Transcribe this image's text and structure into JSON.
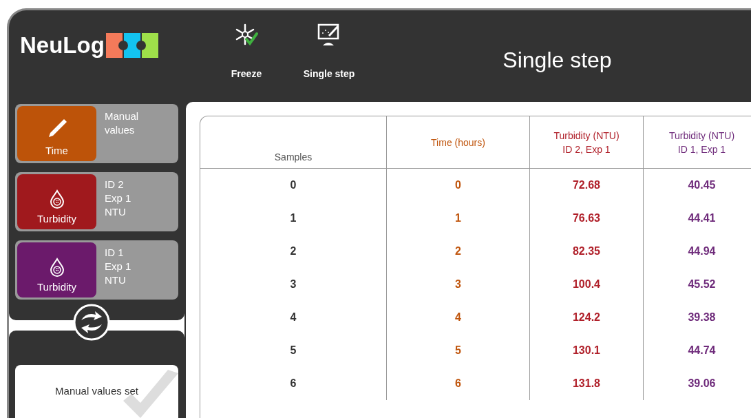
{
  "logo": {
    "text": "NeuLog"
  },
  "toolbar": [
    {
      "label": "Freeze",
      "kind": "freeze"
    },
    {
      "label": "Single step",
      "kind": "step"
    }
  ],
  "title": "Single step",
  "sensors": [
    {
      "name": "Time",
      "kind": "manual",
      "color": "#bd5309",
      "details": [
        "Manual",
        "values"
      ]
    },
    {
      "name": "Turbidity",
      "kind": "turbidity",
      "color": "#a0191d",
      "details": [
        "ID 2",
        "Exp 1",
        "NTU"
      ]
    },
    {
      "name": "Turbidity",
      "kind": "turbidity",
      "color": "#6b1a6b",
      "details": [
        "ID 1",
        "Exp 1",
        "NTU"
      ]
    }
  ],
  "status": {
    "text": "Manual values set"
  },
  "table": {
    "columns": [
      {
        "lines": [
          "Samples"
        ],
        "color": "#555555"
      },
      {
        "lines": [
          "Time (hours)"
        ],
        "color": "#c0560e"
      },
      {
        "lines": [
          "Turbidity (NTU)",
          "ID 2, Exp 1"
        ],
        "color": "#b0202a"
      },
      {
        "lines": [
          "Turbidity (NTU)",
          "ID 1, Exp 1"
        ],
        "color": "#6e2a7a"
      }
    ],
    "rows": [
      [
        "0",
        "0",
        "72.68",
        "40.45"
      ],
      [
        "1",
        "1",
        "76.63",
        "44.41"
      ],
      [
        "2",
        "2",
        "82.35",
        "44.94"
      ],
      [
        "3",
        "3",
        "100.4",
        "45.52"
      ],
      [
        "4",
        "4",
        "124.2",
        "39.38"
      ],
      [
        "5",
        "5",
        "130.1",
        "44.74"
      ],
      [
        "6",
        "6",
        "131.8",
        "39.06"
      ]
    ]
  }
}
